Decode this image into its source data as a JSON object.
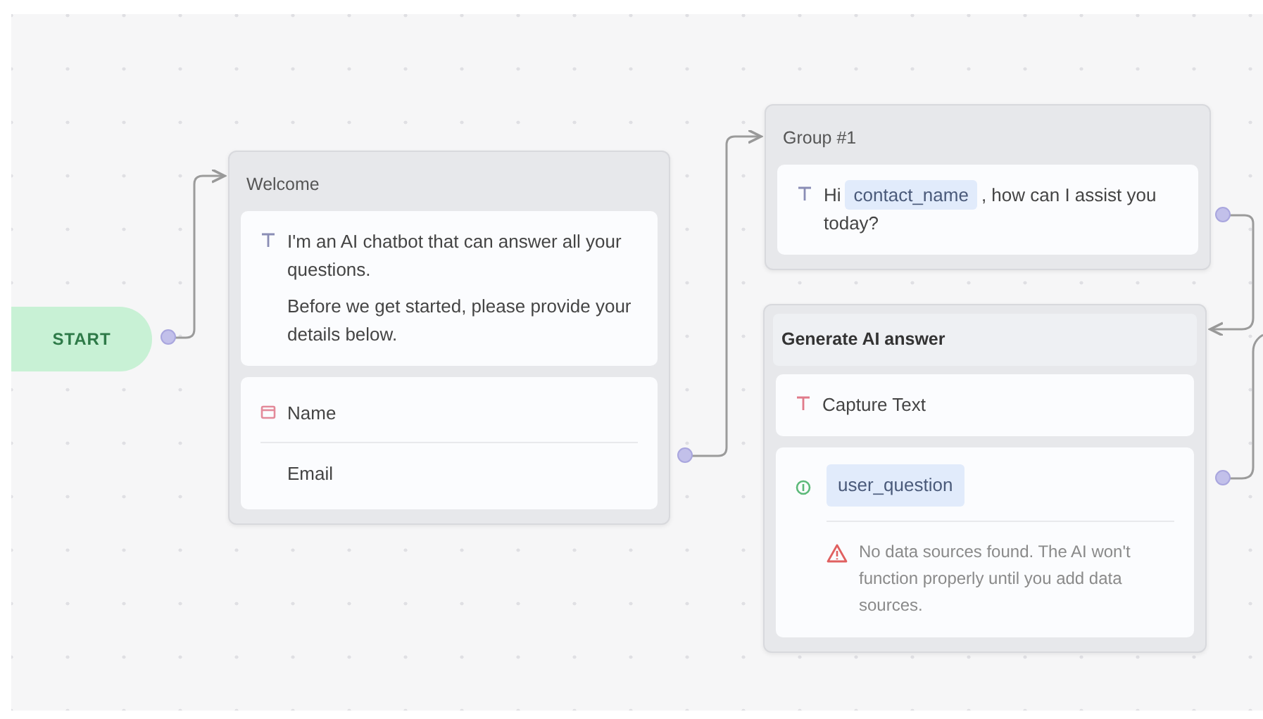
{
  "start": {
    "label": "START"
  },
  "groups": [
    {
      "kind": "group",
      "title": "Welcome",
      "blocks": [
        {
          "kind": "text",
          "paragraphs": [
            [
              {
                "kind": "plain",
                "text": "I'm an AI chatbot that can answer all your questions."
              }
            ],
            [
              {
                "kind": "plain",
                "text": "Before we get started, please provide your details below."
              }
            ]
          ]
        },
        {
          "kind": "form",
          "fields": [
            "Name",
            "Email"
          ]
        }
      ]
    },
    {
      "kind": "group",
      "title": "Group #1",
      "blocks": [
        {
          "kind": "text",
          "paragraphs": [
            [
              {
                "kind": "plain",
                "text": "Hi"
              },
              {
                "kind": "variable",
                "text": "contact_name"
              },
              {
                "kind": "plain",
                "text": ", how can I assist you today?"
              }
            ]
          ]
        }
      ]
    },
    {
      "kind": "action",
      "title": "Generate AI answer",
      "blocks": [
        {
          "kind": "capture",
          "label": "Capture Text"
        },
        {
          "kind": "ai",
          "variable": "user_question",
          "warning": "No data sources found. The AI won't function properly until you add data sources."
        }
      ]
    }
  ]
}
